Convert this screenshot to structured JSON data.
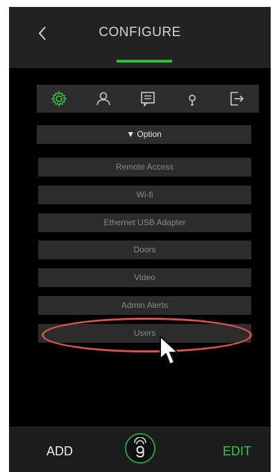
{
  "header": {
    "title": "CONFIGURE",
    "back_icon": "chevron-left-icon",
    "accent_color": "#2fbf3c"
  },
  "tabs": [
    {
      "icon": "gear-icon",
      "active": true
    },
    {
      "icon": "user-icon",
      "active": false
    },
    {
      "icon": "message-icon",
      "active": false
    },
    {
      "icon": "lightbulb-icon",
      "active": false
    },
    {
      "icon": "logout-icon",
      "active": false
    }
  ],
  "option_bar": {
    "label": "▼ Option"
  },
  "menu": {
    "items": [
      {
        "label": "Remote Access"
      },
      {
        "label": "Wi-fi"
      },
      {
        "label": "Ethernet USB Adapter"
      },
      {
        "label": "Doors"
      },
      {
        "label": "Video"
      },
      {
        "label": "Admin Alerts"
      },
      {
        "label": "Users"
      }
    ]
  },
  "footer": {
    "add_label": "ADD",
    "edit_label": "EDIT",
    "logo_icon": "g-logo-icon",
    "edit_color": "#3cc94a"
  },
  "annotation": {
    "highlight_color": "#d9534f",
    "cursor_icon": "arrow-cursor-icon"
  }
}
